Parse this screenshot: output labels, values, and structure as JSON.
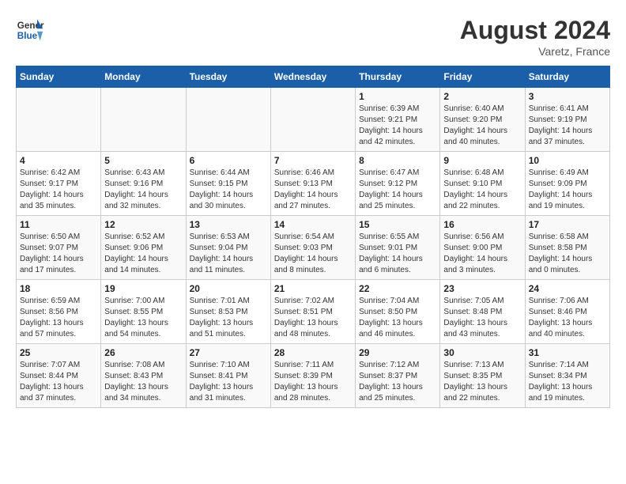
{
  "header": {
    "logo_line1": "General",
    "logo_line2": "Blue",
    "month_year": "August 2024",
    "location": "Varetz, France"
  },
  "weekdays": [
    "Sunday",
    "Monday",
    "Tuesday",
    "Wednesday",
    "Thursday",
    "Friday",
    "Saturday"
  ],
  "weeks": [
    [
      {
        "day": "",
        "detail": ""
      },
      {
        "day": "",
        "detail": ""
      },
      {
        "day": "",
        "detail": ""
      },
      {
        "day": "",
        "detail": ""
      },
      {
        "day": "1",
        "detail": "Sunrise: 6:39 AM\nSunset: 9:21 PM\nDaylight: 14 hours\nand 42 minutes."
      },
      {
        "day": "2",
        "detail": "Sunrise: 6:40 AM\nSunset: 9:20 PM\nDaylight: 14 hours\nand 40 minutes."
      },
      {
        "day": "3",
        "detail": "Sunrise: 6:41 AM\nSunset: 9:19 PM\nDaylight: 14 hours\nand 37 minutes."
      }
    ],
    [
      {
        "day": "4",
        "detail": "Sunrise: 6:42 AM\nSunset: 9:17 PM\nDaylight: 14 hours\nand 35 minutes."
      },
      {
        "day": "5",
        "detail": "Sunrise: 6:43 AM\nSunset: 9:16 PM\nDaylight: 14 hours\nand 32 minutes."
      },
      {
        "day": "6",
        "detail": "Sunrise: 6:44 AM\nSunset: 9:15 PM\nDaylight: 14 hours\nand 30 minutes."
      },
      {
        "day": "7",
        "detail": "Sunrise: 6:46 AM\nSunset: 9:13 PM\nDaylight: 14 hours\nand 27 minutes."
      },
      {
        "day": "8",
        "detail": "Sunrise: 6:47 AM\nSunset: 9:12 PM\nDaylight: 14 hours\nand 25 minutes."
      },
      {
        "day": "9",
        "detail": "Sunrise: 6:48 AM\nSunset: 9:10 PM\nDaylight: 14 hours\nand 22 minutes."
      },
      {
        "day": "10",
        "detail": "Sunrise: 6:49 AM\nSunset: 9:09 PM\nDaylight: 14 hours\nand 19 minutes."
      }
    ],
    [
      {
        "day": "11",
        "detail": "Sunrise: 6:50 AM\nSunset: 9:07 PM\nDaylight: 14 hours\nand 17 minutes."
      },
      {
        "day": "12",
        "detail": "Sunrise: 6:52 AM\nSunset: 9:06 PM\nDaylight: 14 hours\nand 14 minutes."
      },
      {
        "day": "13",
        "detail": "Sunrise: 6:53 AM\nSunset: 9:04 PM\nDaylight: 14 hours\nand 11 minutes."
      },
      {
        "day": "14",
        "detail": "Sunrise: 6:54 AM\nSunset: 9:03 PM\nDaylight: 14 hours\nand 8 minutes."
      },
      {
        "day": "15",
        "detail": "Sunrise: 6:55 AM\nSunset: 9:01 PM\nDaylight: 14 hours\nand 6 minutes."
      },
      {
        "day": "16",
        "detail": "Sunrise: 6:56 AM\nSunset: 9:00 PM\nDaylight: 14 hours\nand 3 minutes."
      },
      {
        "day": "17",
        "detail": "Sunrise: 6:58 AM\nSunset: 8:58 PM\nDaylight: 14 hours\nand 0 minutes."
      }
    ],
    [
      {
        "day": "18",
        "detail": "Sunrise: 6:59 AM\nSunset: 8:56 PM\nDaylight: 13 hours\nand 57 minutes."
      },
      {
        "day": "19",
        "detail": "Sunrise: 7:00 AM\nSunset: 8:55 PM\nDaylight: 13 hours\nand 54 minutes."
      },
      {
        "day": "20",
        "detail": "Sunrise: 7:01 AM\nSunset: 8:53 PM\nDaylight: 13 hours\nand 51 minutes."
      },
      {
        "day": "21",
        "detail": "Sunrise: 7:02 AM\nSunset: 8:51 PM\nDaylight: 13 hours\nand 48 minutes."
      },
      {
        "day": "22",
        "detail": "Sunrise: 7:04 AM\nSunset: 8:50 PM\nDaylight: 13 hours\nand 46 minutes."
      },
      {
        "day": "23",
        "detail": "Sunrise: 7:05 AM\nSunset: 8:48 PM\nDaylight: 13 hours\nand 43 minutes."
      },
      {
        "day": "24",
        "detail": "Sunrise: 7:06 AM\nSunset: 8:46 PM\nDaylight: 13 hours\nand 40 minutes."
      }
    ],
    [
      {
        "day": "25",
        "detail": "Sunrise: 7:07 AM\nSunset: 8:44 PM\nDaylight: 13 hours\nand 37 minutes."
      },
      {
        "day": "26",
        "detail": "Sunrise: 7:08 AM\nSunset: 8:43 PM\nDaylight: 13 hours\nand 34 minutes."
      },
      {
        "day": "27",
        "detail": "Sunrise: 7:10 AM\nSunset: 8:41 PM\nDaylight: 13 hours\nand 31 minutes."
      },
      {
        "day": "28",
        "detail": "Sunrise: 7:11 AM\nSunset: 8:39 PM\nDaylight: 13 hours\nand 28 minutes."
      },
      {
        "day": "29",
        "detail": "Sunrise: 7:12 AM\nSunset: 8:37 PM\nDaylight: 13 hours\nand 25 minutes."
      },
      {
        "day": "30",
        "detail": "Sunrise: 7:13 AM\nSunset: 8:35 PM\nDaylight: 13 hours\nand 22 minutes."
      },
      {
        "day": "31",
        "detail": "Sunrise: 7:14 AM\nSunset: 8:34 PM\nDaylight: 13 hours\nand 19 minutes."
      }
    ]
  ]
}
